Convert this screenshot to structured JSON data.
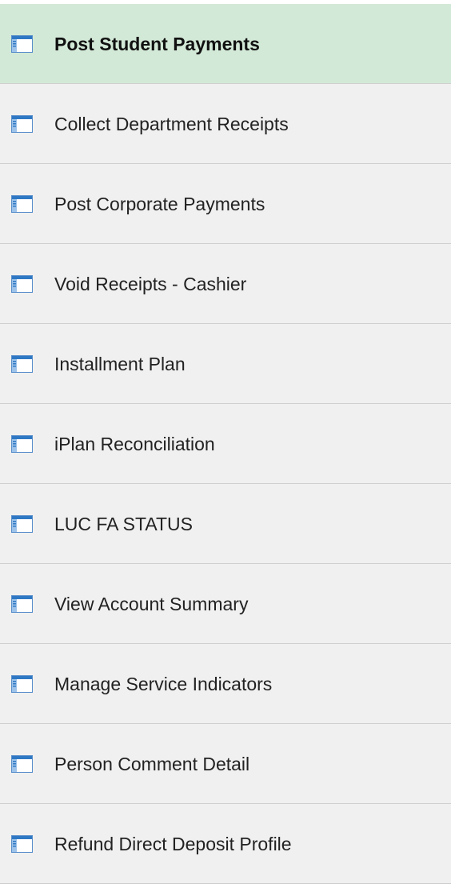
{
  "menu": {
    "items": [
      {
        "label": "Post Student Payments",
        "icon": "component-page-icon",
        "selected": true
      },
      {
        "label": "Collect Department Receipts",
        "icon": "component-page-icon",
        "selected": false
      },
      {
        "label": "Post Corporate Payments",
        "icon": "component-page-icon",
        "selected": false
      },
      {
        "label": "Void Receipts - Cashier",
        "icon": "component-page-icon",
        "selected": false
      },
      {
        "label": "Installment Plan",
        "icon": "component-page-icon",
        "selected": false
      },
      {
        "label": "iPlan Reconciliation",
        "icon": "component-page-icon",
        "selected": false
      },
      {
        "label": "LUC FA STATUS",
        "icon": "component-page-icon",
        "selected": false
      },
      {
        "label": "View Account Summary",
        "icon": "component-page-icon",
        "selected": false
      },
      {
        "label": "Manage Service Indicators",
        "icon": "component-page-icon",
        "selected": false
      },
      {
        "label": "Person Comment Detail",
        "icon": "component-page-icon",
        "selected": false
      },
      {
        "label": "Refund Direct Deposit Profile",
        "icon": "component-page-icon",
        "selected": false
      }
    ]
  },
  "colors": {
    "selected_background": "#d3e9d7",
    "item_background": "#f0f0f0",
    "divider": "#cfcfcf",
    "icon_blue": "#2f78c4"
  }
}
